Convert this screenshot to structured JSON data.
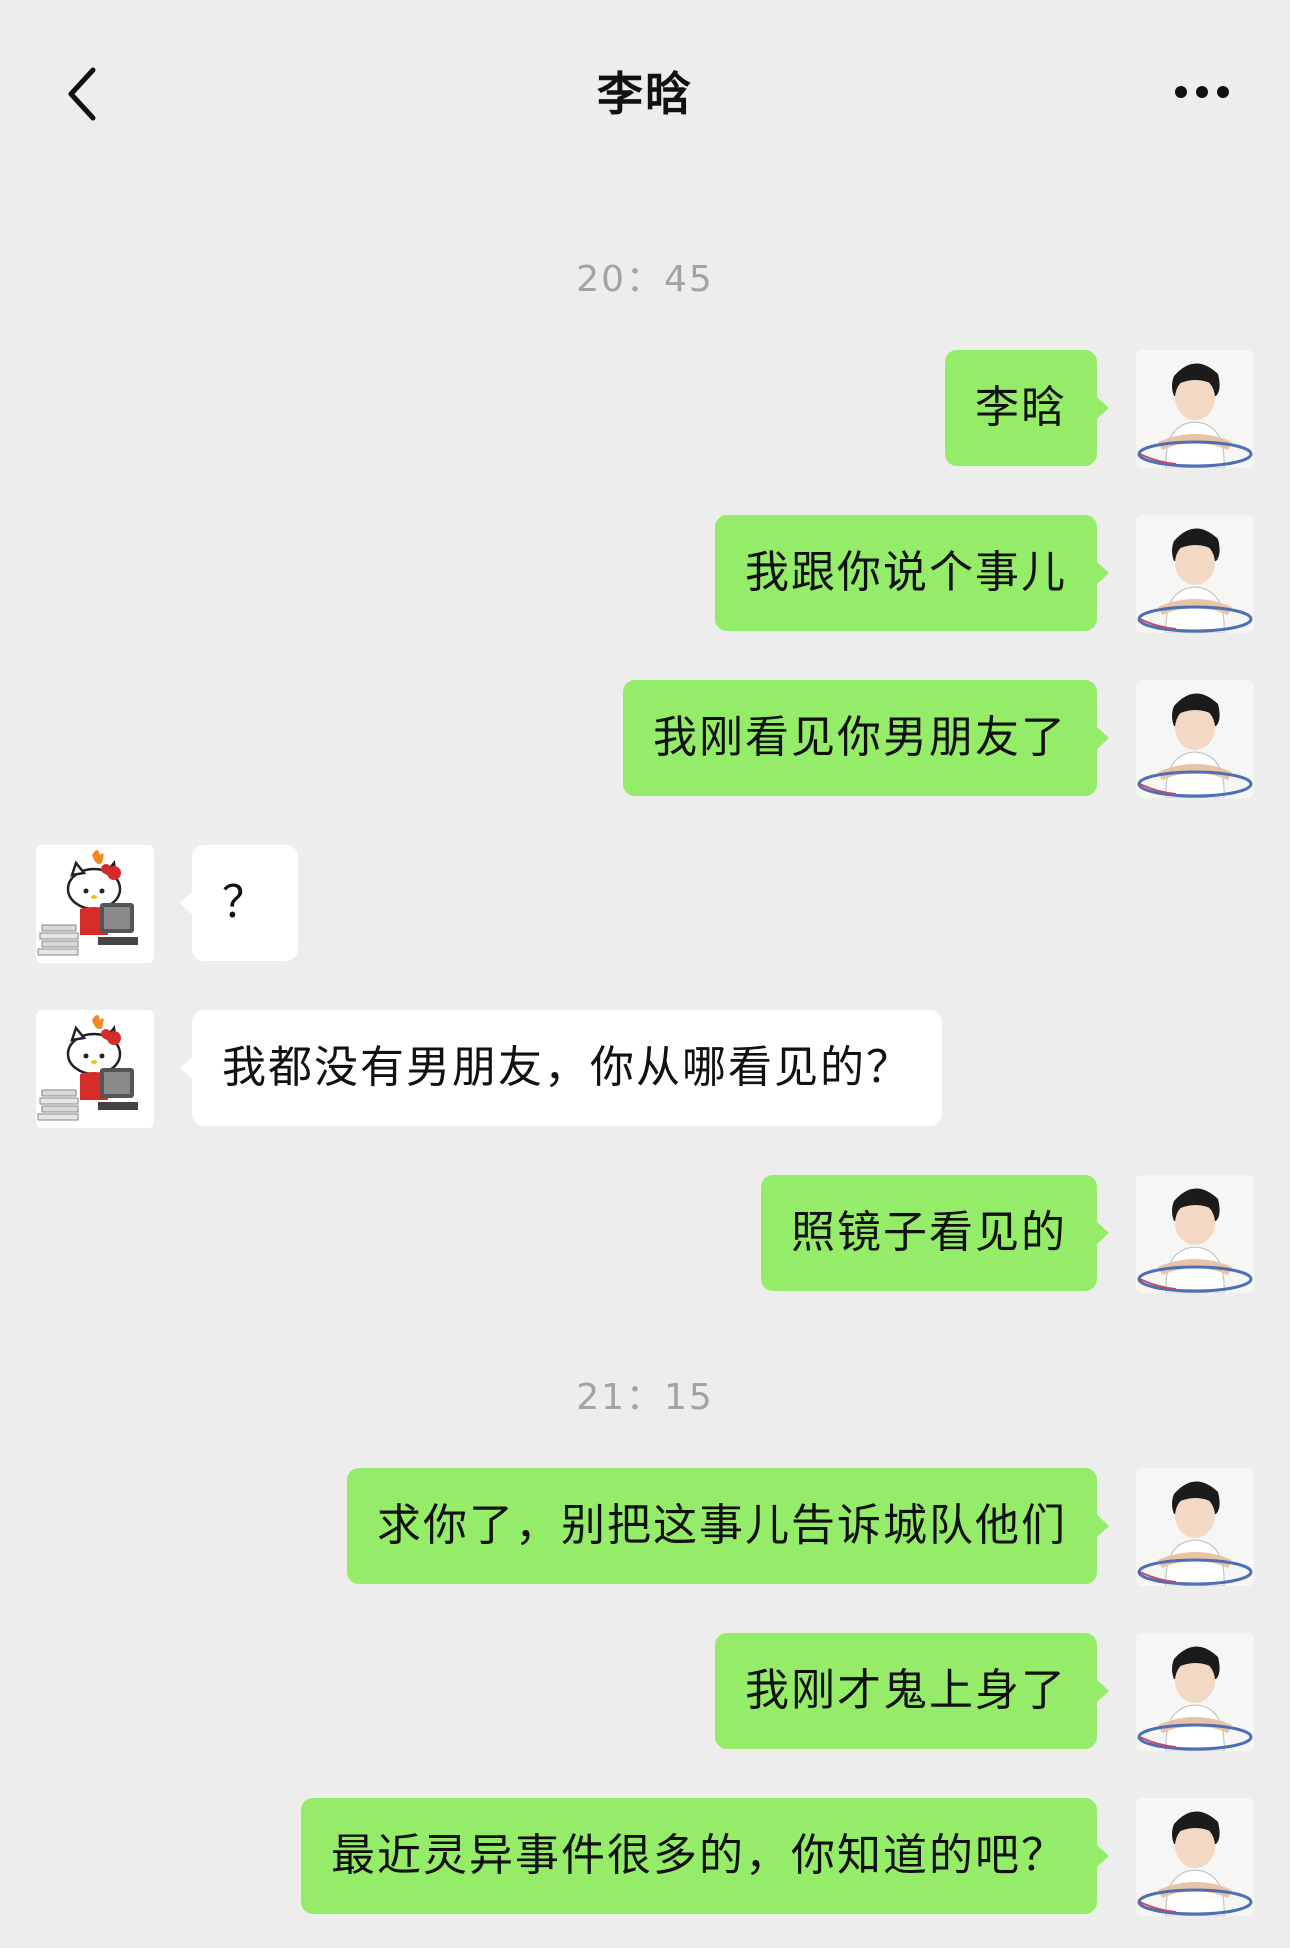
{
  "header": {
    "title": "李晗",
    "back_icon": "chevron-left-icon",
    "more_icon": "more-dots-icon"
  },
  "colors": {
    "background": "#ededed",
    "sent_bubble": "#95ec69",
    "received_bubble": "#ffffff",
    "timestamp": "#a3a3a3"
  },
  "timestamps": [
    "20：45",
    "21：15"
  ],
  "messages": [
    {
      "side": "sent",
      "text": "李晗"
    },
    {
      "side": "sent",
      "text": "我跟你说个事儿"
    },
    {
      "side": "sent",
      "text": "我刚看见你男朋友了"
    },
    {
      "side": "received",
      "text": "？"
    },
    {
      "side": "received",
      "text": "我都没有男朋友，你从哪看见的？"
    },
    {
      "side": "sent",
      "text": "照镜子看见的"
    },
    {
      "side": "sent",
      "text": "求你了，别把这事儿告诉城队他们"
    },
    {
      "side": "sent",
      "text": "我刚才鬼上身了"
    },
    {
      "side": "sent",
      "text": "最近灵异事件很多的，你知道的吧？"
    }
  ]
}
